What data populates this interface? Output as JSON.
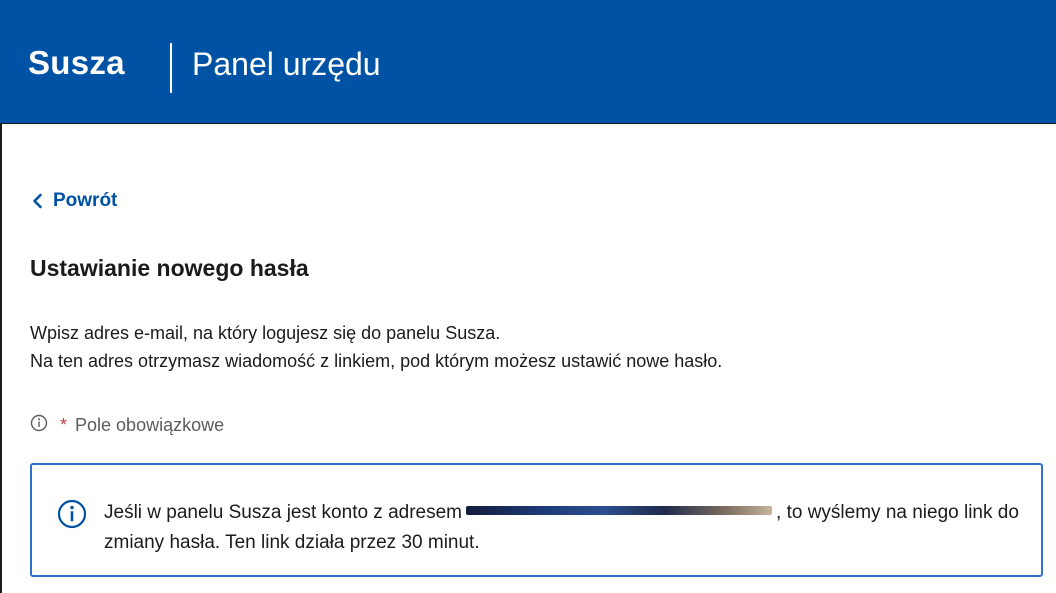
{
  "header": {
    "brand": "Susza",
    "panel_name": "Panel urzędu",
    "background_color": "#0052a5"
  },
  "navigation": {
    "back_label": "Powrót",
    "back_icon": "chevron-left-icon"
  },
  "main": {
    "title": "Ustawianie nowego hasła",
    "intro_line_1": "Wpisz adres e-mail, na który logujesz się do panelu Susza.",
    "intro_line_2": "Na ten adres otrzymasz wiadomość z linkiem, pod którym możesz ustawić nowe hasło.",
    "required_marker": "*",
    "required_label": "Pole obowiązkowe",
    "required_icon": "info-icon"
  },
  "info_box": {
    "icon": "info-circle-icon",
    "text_before_email": "Jeśli w panelu Susza jest konto z adresem",
    "email_redacted": true,
    "text_after_email": ", to wyślemy na niego link do zmiany hasła. Ten link działa przez 30 minut.",
    "border_color": "#2f6fd0"
  },
  "colors": {
    "link": "#0052a5",
    "required_star": "#c43d4b",
    "muted_text": "#5c5c5c"
  }
}
